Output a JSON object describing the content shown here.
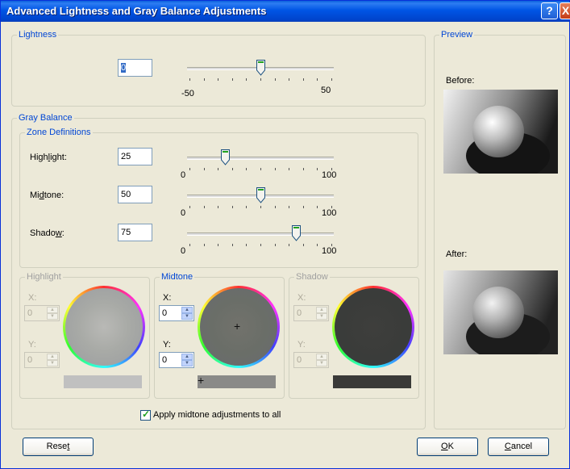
{
  "window": {
    "title": "Advanced Lightness and Gray Balance Adjustments",
    "help_glyph": "?",
    "close_glyph": "X"
  },
  "lightness": {
    "group_label": "Lightness",
    "value": "0",
    "slider": {
      "min_label": "-50",
      "max_label": "50",
      "value": 0,
      "min": -50,
      "max": 50
    }
  },
  "gray_balance": {
    "group_label": "Gray Balance",
    "zone_label": "Zone Definitions",
    "zones": [
      {
        "label_pre": "High",
        "label_u": "l",
        "label_post": "ight:",
        "value": "25",
        "slider_value": 25,
        "min_label": "0",
        "max_label": "100"
      },
      {
        "label_pre": "Mi",
        "label_u": "d",
        "label_post": "tone:",
        "value": "50",
        "slider_value": 50,
        "min_label": "0",
        "max_label": "100"
      },
      {
        "label_pre": "Shado",
        "label_u": "w",
        "label_post": ":",
        "value": "75",
        "slider_value": 75,
        "min_label": "0",
        "max_label": "100"
      }
    ],
    "wheels": [
      {
        "label": "Highlight",
        "x_label": "X:",
        "y_label": "Y:",
        "x": "0",
        "y": "0",
        "enabled": false,
        "swatch_color": "#c0c0c0"
      },
      {
        "label": "Midtone",
        "x_label": "X:",
        "y_label": "Y:",
        "x": "0",
        "y": "0",
        "enabled": true,
        "swatch_color": "#8a8a88",
        "crosshair": "+"
      },
      {
        "label": "Shadow",
        "x_label": "X:",
        "y_label": "Y:",
        "x": "0",
        "y": "0",
        "enabled": false,
        "swatch_color": "#3a3a38"
      }
    ],
    "apply_all_label": "Apply midtone adjustments to all",
    "apply_all_checked": true
  },
  "preview": {
    "group_label": "Preview",
    "before_label": "Before:",
    "after_label": "After:"
  },
  "buttons": {
    "reset_pre": "Rese",
    "reset_u": "t",
    "ok_pre": "",
    "ok_u": "O",
    "ok_post": "K",
    "cancel_pre": "",
    "cancel_u": "C",
    "cancel_post": "ancel"
  },
  "colors": {
    "accent": "#0046d5",
    "titlebar": "#0055e5",
    "dialog_bg": "#ece9d8"
  }
}
